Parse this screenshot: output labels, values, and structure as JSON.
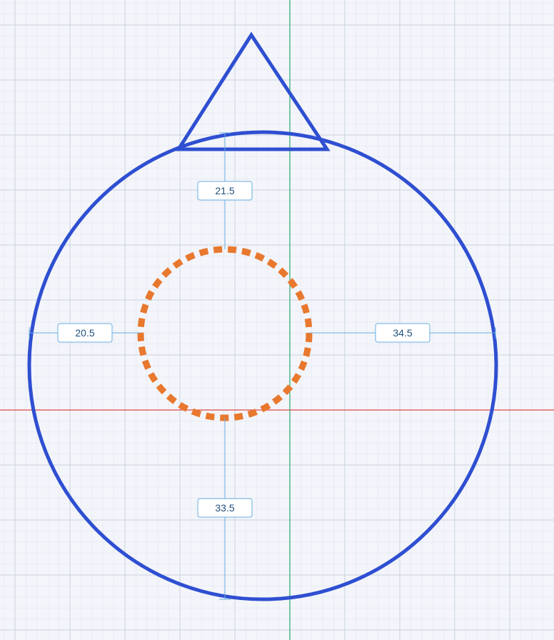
{
  "colors": {
    "background": "#f3f5fa",
    "grid_minor": "#e2e7f0",
    "grid_major": "#c9d2e0",
    "axis_x": "#e04848",
    "axis_y": "#2ea56b",
    "outer_circle": "#2f4fd1",
    "triangle": "#2f4fd1",
    "inner_circle": "#e8782e",
    "dimension_line": "#6aaee0",
    "label_border": "#6aaee0",
    "label_fill": "#ffffff",
    "label_text": "#1f4e7a"
  },
  "shapes": {
    "outer_circle": {
      "stroke_style": "solid"
    },
    "triangle": {
      "stroke_style": "solid"
    },
    "inner_circle": {
      "stroke_style": "dashed"
    }
  },
  "dimensions": {
    "top": {
      "value": "21.5"
    },
    "left": {
      "value": "20.5"
    },
    "right": {
      "value": "34.5"
    },
    "bottom": {
      "value": "33.5"
    }
  }
}
